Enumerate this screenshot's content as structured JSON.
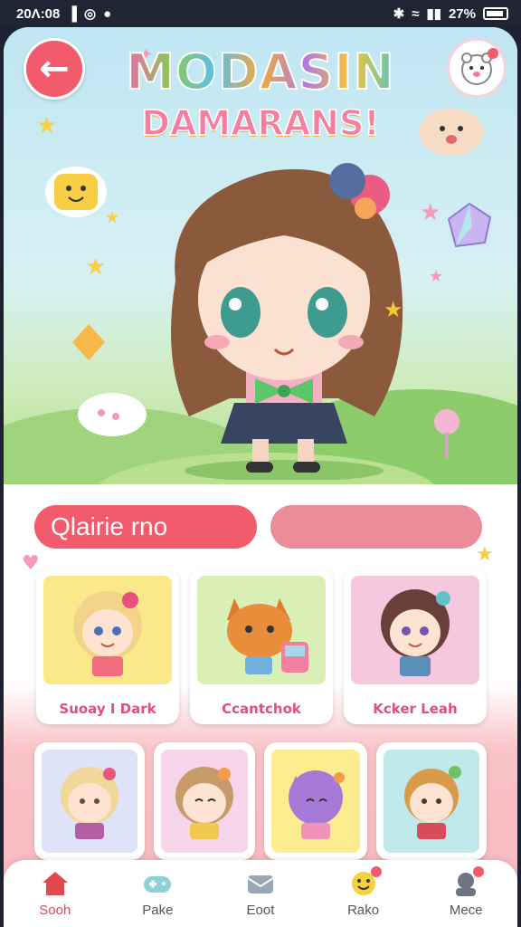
{
  "status_bar": {
    "time": "20Λ:08",
    "battery_text": "27%"
  },
  "header": {
    "title_main": "MODASIN",
    "title_sub": "DAMARANS!"
  },
  "tabs": {
    "active_label": "Qlairie rno",
    "inactive_label": ""
  },
  "cards_row1": [
    {
      "label": "Suoay I Dark"
    },
    {
      "label": "Ccantchok"
    },
    {
      "label": "Kcker Leah"
    }
  ],
  "cards_row2": [
    {
      "label": ""
    },
    {
      "label": ""
    },
    {
      "label": ""
    },
    {
      "label": ""
    }
  ],
  "nav": [
    {
      "label": "Sooh",
      "icon": "home-icon"
    },
    {
      "label": "Pake",
      "icon": "game-icon"
    },
    {
      "label": "Eoot",
      "icon": "mail-icon"
    },
    {
      "label": "Rako",
      "icon": "smile-icon"
    },
    {
      "label": "Mece",
      "icon": "profile-icon"
    }
  ],
  "colors": {
    "accent": "#f25b6b",
    "tab_inactive": "#eb8c98"
  }
}
